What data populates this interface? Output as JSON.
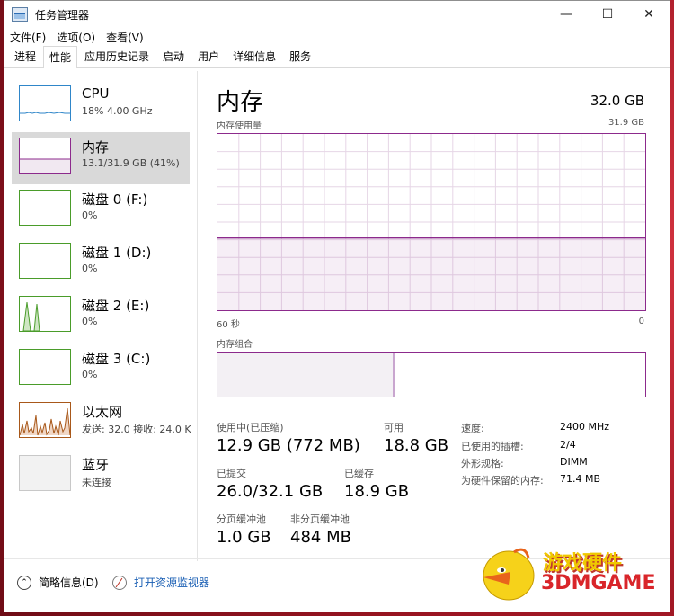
{
  "window": {
    "title": "任务管理器"
  },
  "controls": {
    "minimize": "—",
    "maximize": "☐",
    "close": "✕"
  },
  "menu": [
    "文件(F)",
    "选项(O)",
    "查看(V)"
  ],
  "tabs": [
    "进程",
    "性能",
    "应用历史记录",
    "启动",
    "用户",
    "详细信息",
    "服务"
  ],
  "sidebar": {
    "items": [
      {
        "title": "CPU",
        "sub": "18% 4.00 GHz"
      },
      {
        "title": "内存",
        "sub": "13.1/31.9 GB (41%)"
      },
      {
        "title": "磁盘 0 (F:)",
        "sub": "0%"
      },
      {
        "title": "磁盘 1 (D:)",
        "sub": "0%"
      },
      {
        "title": "磁盘 2 (E:)",
        "sub": "0%"
      },
      {
        "title": "磁盘 3 (C:)",
        "sub": "0%"
      },
      {
        "title": "以太网",
        "sub": "发送: 32.0  接收: 24.0 K"
      },
      {
        "title": "蓝牙",
        "sub": "未连接"
      }
    ]
  },
  "main": {
    "title": "内存",
    "total": "32.0 GB",
    "graph_label": "内存使用量",
    "graph_max": "31.9 GB",
    "axis_left": "60 秒",
    "axis_right": "0",
    "memory_usage_fraction": 0.41,
    "combo_label": "内存组合",
    "combo_used_fraction": 0.41
  },
  "stats": {
    "in_use_label": "使用中(已压缩)",
    "in_use_value": "12.9 GB (772 MB)",
    "available_label": "可用",
    "available_value": "18.8 GB",
    "committed_label": "已提交",
    "committed_value": "26.0/32.1 GB",
    "cached_label": "已缓存",
    "cached_value": "18.9 GB",
    "paged_label": "分页缓冲池",
    "paged_value": "1.0 GB",
    "nonpaged_label": "非分页缓冲池",
    "nonpaged_value": "484 MB"
  },
  "specs": {
    "speed_label": "速度:",
    "speed_value": "2400 MHz",
    "slots_label": "已使用的插槽:",
    "slots_value": "2/4",
    "form_label": "外形规格:",
    "form_value": "DIMM",
    "reserved_label": "为硬件保留的内存:",
    "reserved_value": "71.4 MB"
  },
  "footer": {
    "fewer_details": "简略信息(D)",
    "open_resmon": "打开资源监视器"
  },
  "watermark": {
    "line1": "游戏硬件",
    "line2": "3DMGAME"
  },
  "colors": {
    "accent": "#8c2a8c",
    "cpu": "#2f86c9",
    "disk": "#4a9c2a",
    "ethernet": "#a8581a",
    "selected_bg": "#d9d9d9"
  }
}
